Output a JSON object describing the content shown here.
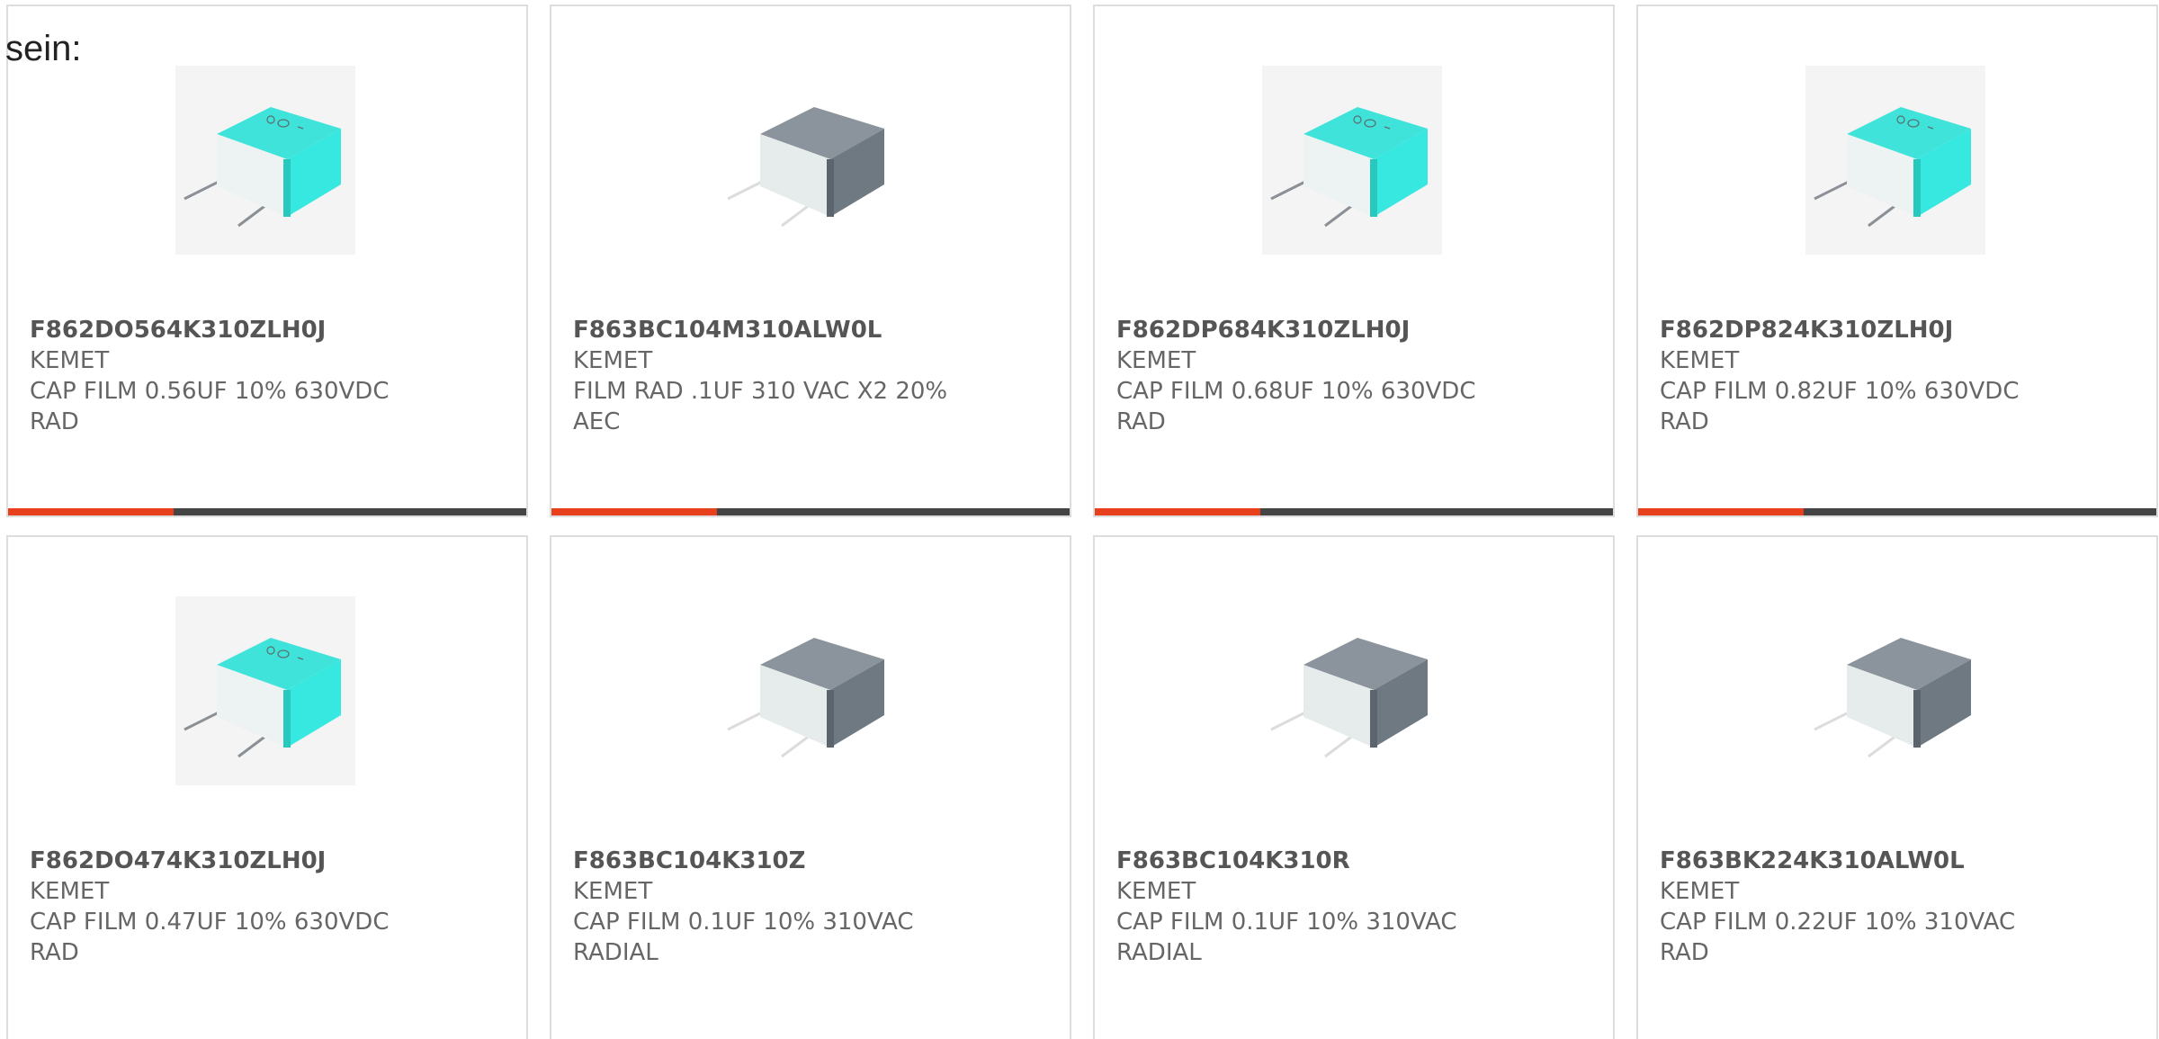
{
  "intro_text": "sein:",
  "colors": {
    "accent": "#e8401c",
    "track": "#444444",
    "teal_body": "#2fd6cc",
    "grey_body": "#76808a"
  },
  "products": [
    {
      "part_number": "F862DO564K310ZLH0J",
      "manufacturer": "KEMET",
      "description": "CAP FILM 0.56UF 10% 630VDC RAD",
      "image": "teal-capacitor-image",
      "progress_fraction": 0.32
    },
    {
      "part_number": "F863BC104M310ALW0L",
      "manufacturer": "KEMET",
      "description": "FILM RAD .1UF 310 VAC X2 20% AEC",
      "image": "grey-capacitor-image",
      "progress_fraction": 0.32
    },
    {
      "part_number": "F862DP684K310ZLH0J",
      "manufacturer": "KEMET",
      "description": "CAP FILM 0.68UF 10% 630VDC RAD",
      "image": "teal-capacitor-image",
      "progress_fraction": 0.32
    },
    {
      "part_number": "F862DP824K310ZLH0J",
      "manufacturer": "KEMET",
      "description": "CAP FILM 0.82UF 10% 630VDC RAD",
      "image": "teal-capacitor-image",
      "progress_fraction": 0.32
    },
    {
      "part_number": "F862DO474K310ZLH0J",
      "manufacturer": "KEMET",
      "description": "CAP FILM 0.47UF 10% 630VDC RAD",
      "image": "teal-capacitor-image"
    },
    {
      "part_number": "F863BC104K310Z",
      "manufacturer": "KEMET",
      "description": "CAP FILM 0.1UF 10% 310VAC RADIAL",
      "image": "grey-capacitor-image"
    },
    {
      "part_number": "F863BC104K310R",
      "manufacturer": "KEMET",
      "description": "CAP FILM 0.1UF 10% 310VAC RADIAL",
      "image": "grey-capacitor-image"
    },
    {
      "part_number": "F863BK224K310ALW0L",
      "manufacturer": "KEMET",
      "description": "CAP FILM 0.22UF 10% 310VAC RAD",
      "image": "grey-capacitor-image"
    }
  ]
}
